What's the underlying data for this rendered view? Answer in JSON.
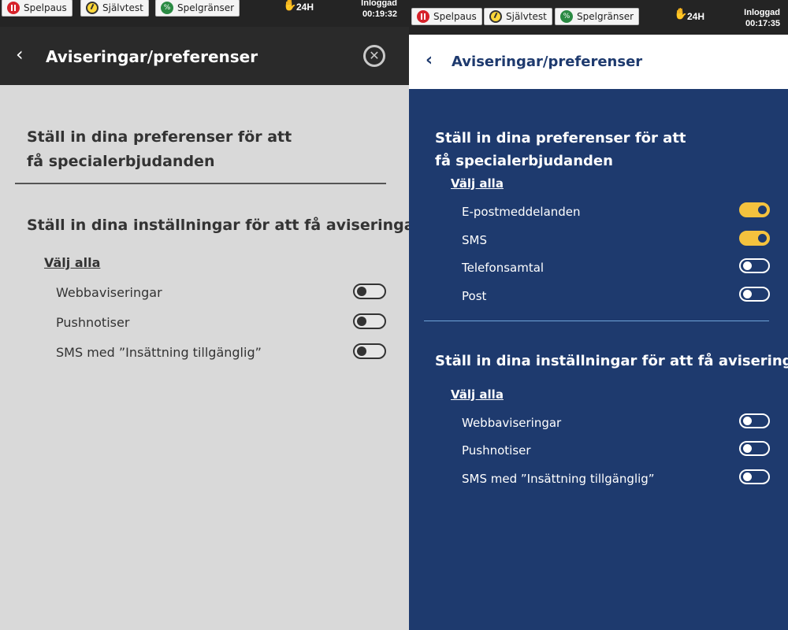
{
  "left": {
    "topbar": {
      "pause_label": "Spelpaus",
      "selftest_label": "Självtest",
      "limits_label": "Spelgränser",
      "timer_24h": "24H",
      "login_label": "Inloggad",
      "login_time": "00:19:32"
    },
    "header": {
      "title": "Aviseringar/preferenser"
    },
    "offers": {
      "heading": "Ställ in dina preferenser för att få specialerbjudanden"
    },
    "notifications": {
      "heading": "Ställ in dina inställningar för att få aviseringar",
      "select_all": "Välj alla",
      "options": [
        {
          "label": "Webbaviseringar",
          "enabled": false
        },
        {
          "label": "Pushnotiser",
          "enabled": false
        },
        {
          "label": "SMS med ”Insättning tillgänglig”",
          "enabled": false
        }
      ]
    }
  },
  "right": {
    "topbar": {
      "pause_label": "Spelpaus",
      "selftest_label": "Självtest",
      "limits_label": "Spelgränser",
      "timer_24h": "24H",
      "login_label": "Inloggad",
      "login_time": "00:17:35"
    },
    "header": {
      "title": "Aviseringar/preferenser"
    },
    "offers": {
      "heading": "Ställ in dina preferenser för att få specialerbjudanden",
      "select_all": "Välj alla",
      "options": [
        {
          "label": "E-postmeddelanden",
          "enabled": true
        },
        {
          "label": "SMS",
          "enabled": true
        },
        {
          "label": "Telefonsamtal",
          "enabled": false
        },
        {
          "label": "Post",
          "enabled": false
        }
      ]
    },
    "notifications": {
      "heading": "Ställ in dina inställningar för att få aviseringar",
      "select_all": "Välj alla",
      "options": [
        {
          "label": "Webbaviseringar",
          "enabled": false
        },
        {
          "label": "Pushnotiser",
          "enabled": false
        },
        {
          "label": "SMS med ”Insättning tillgänglig”",
          "enabled": false
        }
      ]
    }
  },
  "colors": {
    "right_background": "#1e3a6e",
    "left_background": "#d9d9d9",
    "toggle_on": "#f4c23e",
    "pause_red": "#d6222a"
  },
  "icons": {
    "pause": "pause-icon",
    "selftest": "gauge-icon",
    "limits": "limits-icon",
    "hand": "hand-icon",
    "back": "back-chevron-icon",
    "close": "close-icon"
  }
}
